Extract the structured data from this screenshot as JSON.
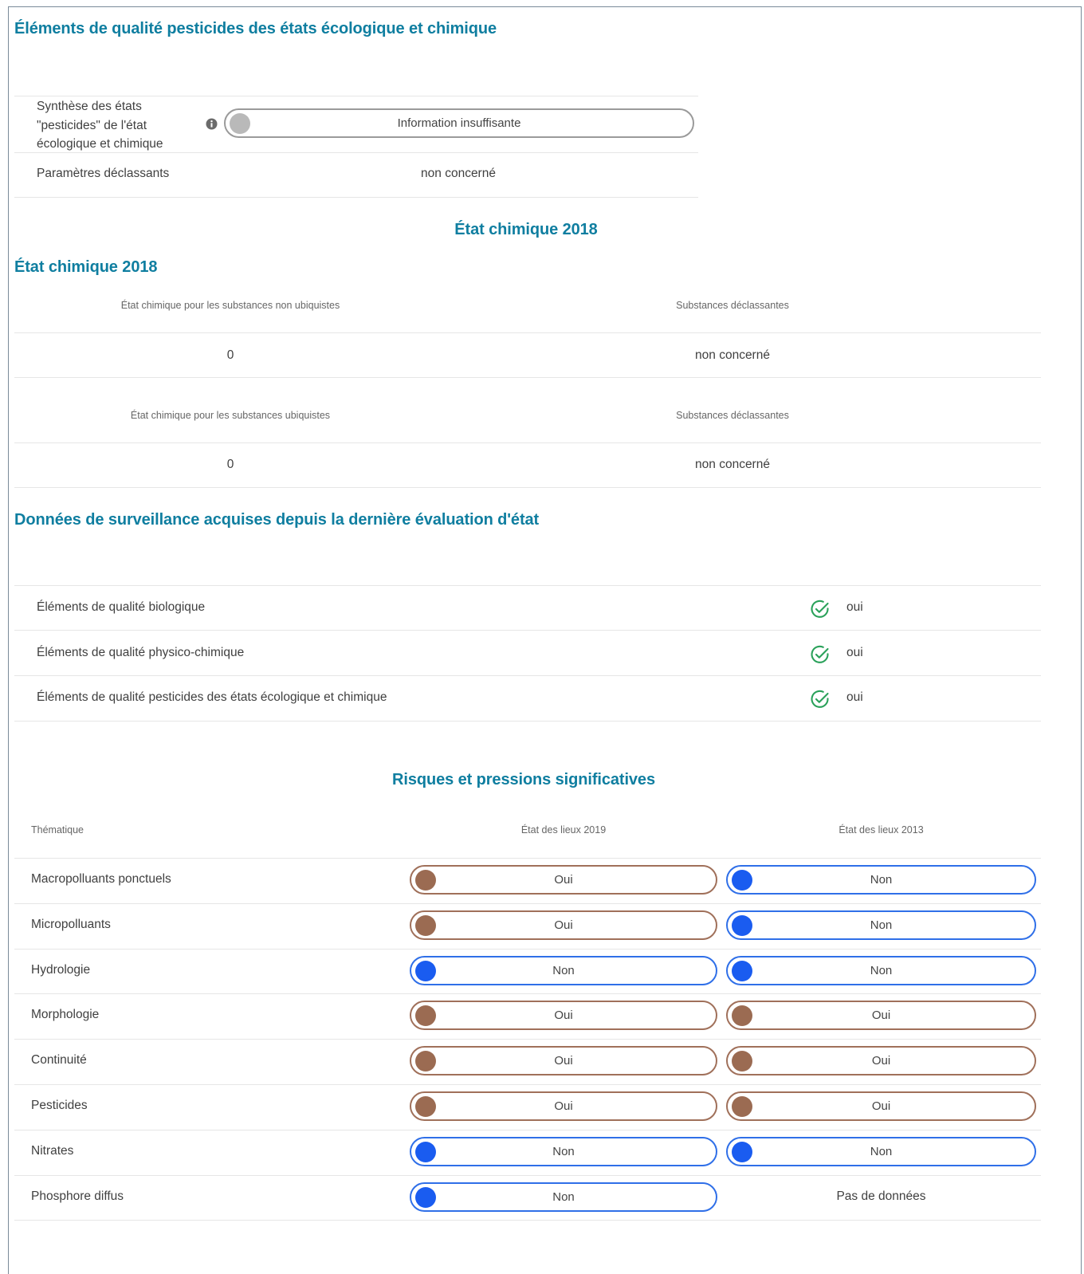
{
  "section1": {
    "title": "Éléments de qualité pesticides des états écologique et chimique",
    "synthese_label_lines": [
      "Synthèse des états",
      "\"pesticides\" de l'état",
      "écologique et chimique"
    ],
    "synthese_value": "Information insuffisante",
    "parametres_label": "Paramètres déclassants",
    "parametres_value": "non concerné"
  },
  "section2": {
    "centered_title": "État chimique 2018",
    "title": "État chimique 2018",
    "non_ubiq_header": "État chimique pour les substances non ubiquistes",
    "subst_header_1": "Substances déclassantes",
    "non_ubiq_value": "0",
    "non_ubiq_subst_value": "non concerné",
    "ubiq_header": "État chimique pour les substances ubiquistes",
    "subst_header_2": "Substances déclassantes",
    "ubiq_value": "0",
    "ubiq_subst_value": "non concerné"
  },
  "section3": {
    "title": "Données de surveillance acquises depuis la dernière évaluation d'état",
    "rows": [
      {
        "label": "Éléments de qualité biologique",
        "value": "oui"
      },
      {
        "label": "Éléments de qualité physico-chimique",
        "value": "oui"
      },
      {
        "label": "Éléments de qualité pesticides des états écologique et chimique",
        "value": "oui"
      }
    ]
  },
  "section4": {
    "title": "Risques et pressions significatives",
    "col_theme": "Thématique",
    "col_2019": "État des lieux 2019",
    "col_2013": "État des lieux 2013",
    "rows": [
      {
        "theme": "Macropolluants ponctuels",
        "v2019": "Oui",
        "v2013": "Non"
      },
      {
        "theme": "Micropolluants",
        "v2019": "Oui",
        "v2013": "Non"
      },
      {
        "theme": "Hydrologie",
        "v2019": "Non",
        "v2013": "Non"
      },
      {
        "theme": "Morphologie",
        "v2019": "Oui",
        "v2013": "Oui"
      },
      {
        "theme": "Continuité",
        "v2019": "Oui",
        "v2013": "Oui"
      },
      {
        "theme": "Pesticides",
        "v2019": "Oui",
        "v2013": "Oui"
      },
      {
        "theme": "Nitrates",
        "v2019": "Non",
        "v2013": "Non"
      },
      {
        "theme": "Phosphore diffus",
        "v2019": "Non",
        "v2013": "Pas de données"
      }
    ]
  },
  "colors": {
    "heading": "#0f7ea0",
    "oui": "#9b6b52",
    "non": "#1a5cf0",
    "check": "#2aa15a"
  },
  "icons": {
    "info": "info-icon",
    "check": "check-circle-icon"
  }
}
